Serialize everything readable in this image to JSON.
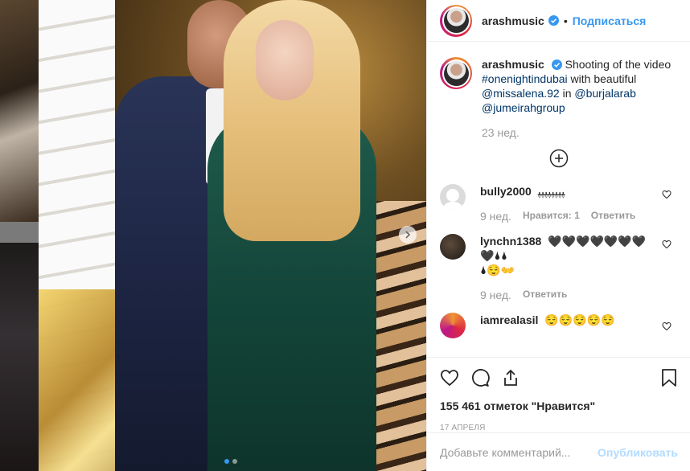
{
  "header": {
    "username": "arashmusic",
    "follow_label": "Подписаться"
  },
  "caption": {
    "username": "arashmusic",
    "text_1": "Shooting of the video",
    "hashtag": "#onenightindubai",
    "text_2": "with beautiful",
    "mention_1": "@missalena.92",
    "text_3": "in",
    "mention_2": "@burjalarab",
    "mention_3": "@jumeirahgroup",
    "time": "23 нед."
  },
  "comments": [
    {
      "username": "bully2000",
      "text": "ﭙﭙﭙﭙﭙﭙﭙﭙ",
      "time": "9 нед.",
      "likes": "Нравится: 1",
      "reply": "Ответить"
    },
    {
      "username": "lynchn1388",
      "text": "🖤🖤🖤🖤🖤🖤🖤🖤🌢🌢",
      "text_2": "🌢😌👐",
      "time": "9 нед.",
      "reply": "Ответить"
    },
    {
      "username": "iamrealasil",
      "text": "😌😌😌😌😌"
    }
  ],
  "stats": {
    "likes": "155 461 отметок \"Нравится\"",
    "date": "17 АПРЕЛЯ"
  },
  "add_comment": {
    "placeholder": "Добавьте комментарий...",
    "publish_label": "Опубликовать"
  },
  "colors": {
    "accent": "#3897f0",
    "link": "#003569",
    "muted": "#999999",
    "publish_disabled": "#b3dbff"
  },
  "carousel": {
    "total": 2,
    "active": 1
  }
}
